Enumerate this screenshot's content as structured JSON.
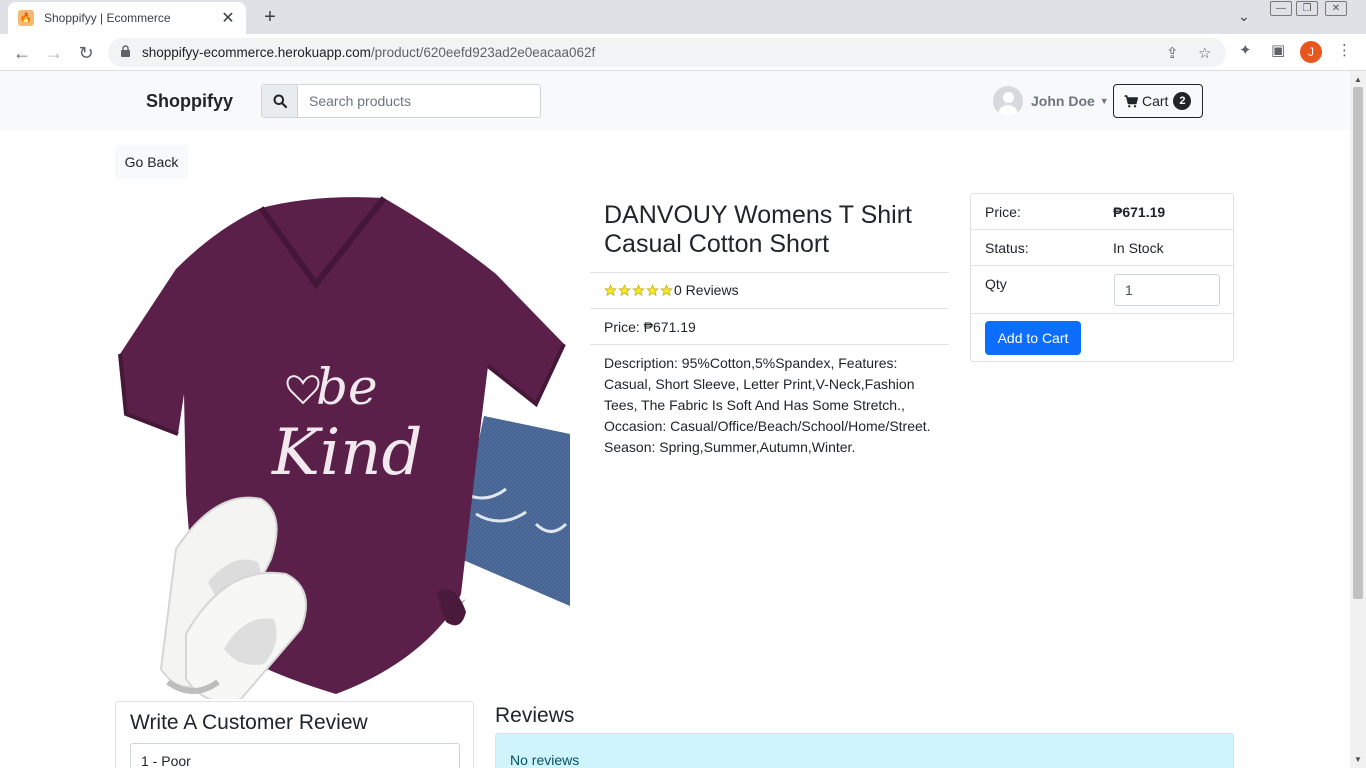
{
  "browser": {
    "tab_title": "Shoppifyy | Ecommerce",
    "url_host": "shoppifyy-ecommerce.herokuapp.com",
    "url_path": "/product/620eefd923ad2e0eacaa062f",
    "profile_initial": "J"
  },
  "nav": {
    "brand": "Shoppifyy",
    "search_placeholder": "Search products",
    "user_name": "John Doe",
    "cart_label": "Cart",
    "cart_count": "2"
  },
  "page": {
    "go_back": "Go Back"
  },
  "product": {
    "title": "DANVOUY Womens T Shirt Casual Cotton Short",
    "rating": 5,
    "reviews_text": "0 Reviews",
    "price_text": "Price: ₱671.19",
    "description": "Description: 95%Cotton,5%Spandex, Features: Casual, Short Sleeve, Letter Print,V-Neck,Fashion Tees, The Fabric Is Soft And Has Some Stretch., Occasion: Casual/Office/Beach/School/Home/Street. Season: Spring,Summer,Autumn,Winter.",
    "shirt_text_line1": "be",
    "shirt_text_line2": "Kind"
  },
  "buybox": {
    "price_label": "Price:",
    "price_value": "₱671.19",
    "status_label": "Status:",
    "status_value": "In Stock",
    "qty_label": "Qty",
    "qty_value": "1",
    "add_to_cart": "Add to Cart"
  },
  "review_form": {
    "title": "Write A Customer Review",
    "rating_selected": "1 - Poor"
  },
  "reviews": {
    "title": "Reviews",
    "empty_message": "No reviews"
  },
  "colors": {
    "primary": "#0d6efd",
    "shirt": "#5b2049",
    "alert_bg": "#cff4fc",
    "star": "#f8e825"
  }
}
